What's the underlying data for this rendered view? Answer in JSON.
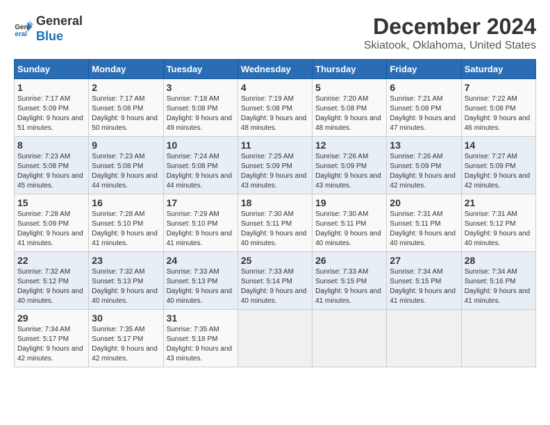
{
  "logo": {
    "text_general": "General",
    "text_blue": "Blue"
  },
  "title": "December 2024",
  "subtitle": "Skiatook, Oklahoma, United States",
  "calendar": {
    "headers": [
      "Sunday",
      "Monday",
      "Tuesday",
      "Wednesday",
      "Thursday",
      "Friday",
      "Saturday"
    ],
    "weeks": [
      [
        {
          "day": "1",
          "sunrise": "7:17 AM",
          "sunset": "5:09 PM",
          "daylight": "9 hours and 51 minutes."
        },
        {
          "day": "2",
          "sunrise": "7:17 AM",
          "sunset": "5:08 PM",
          "daylight": "9 hours and 50 minutes."
        },
        {
          "day": "3",
          "sunrise": "7:18 AM",
          "sunset": "5:08 PM",
          "daylight": "9 hours and 49 minutes."
        },
        {
          "day": "4",
          "sunrise": "7:19 AM",
          "sunset": "5:08 PM",
          "daylight": "9 hours and 48 minutes."
        },
        {
          "day": "5",
          "sunrise": "7:20 AM",
          "sunset": "5:08 PM",
          "daylight": "9 hours and 48 minutes."
        },
        {
          "day": "6",
          "sunrise": "7:21 AM",
          "sunset": "5:08 PM",
          "daylight": "9 hours and 47 minutes."
        },
        {
          "day": "7",
          "sunrise": "7:22 AM",
          "sunset": "5:08 PM",
          "daylight": "9 hours and 46 minutes."
        }
      ],
      [
        {
          "day": "8",
          "sunrise": "7:23 AM",
          "sunset": "5:08 PM",
          "daylight": "9 hours and 45 minutes."
        },
        {
          "day": "9",
          "sunrise": "7:23 AM",
          "sunset": "5:08 PM",
          "daylight": "9 hours and 44 minutes."
        },
        {
          "day": "10",
          "sunrise": "7:24 AM",
          "sunset": "5:08 PM",
          "daylight": "9 hours and 44 minutes."
        },
        {
          "day": "11",
          "sunrise": "7:25 AM",
          "sunset": "5:09 PM",
          "daylight": "9 hours and 43 minutes."
        },
        {
          "day": "12",
          "sunrise": "7:26 AM",
          "sunset": "5:09 PM",
          "daylight": "9 hours and 43 minutes."
        },
        {
          "day": "13",
          "sunrise": "7:26 AM",
          "sunset": "5:09 PM",
          "daylight": "9 hours and 42 minutes."
        },
        {
          "day": "14",
          "sunrise": "7:27 AM",
          "sunset": "5:09 PM",
          "daylight": "9 hours and 42 minutes."
        }
      ],
      [
        {
          "day": "15",
          "sunrise": "7:28 AM",
          "sunset": "5:09 PM",
          "daylight": "9 hours and 41 minutes."
        },
        {
          "day": "16",
          "sunrise": "7:28 AM",
          "sunset": "5:10 PM",
          "daylight": "9 hours and 41 minutes."
        },
        {
          "day": "17",
          "sunrise": "7:29 AM",
          "sunset": "5:10 PM",
          "daylight": "9 hours and 41 minutes."
        },
        {
          "day": "18",
          "sunrise": "7:30 AM",
          "sunset": "5:11 PM",
          "daylight": "9 hours and 40 minutes."
        },
        {
          "day": "19",
          "sunrise": "7:30 AM",
          "sunset": "5:11 PM",
          "daylight": "9 hours and 40 minutes."
        },
        {
          "day": "20",
          "sunrise": "7:31 AM",
          "sunset": "5:11 PM",
          "daylight": "9 hours and 40 minutes."
        },
        {
          "day": "21",
          "sunrise": "7:31 AM",
          "sunset": "5:12 PM",
          "daylight": "9 hours and 40 minutes."
        }
      ],
      [
        {
          "day": "22",
          "sunrise": "7:32 AM",
          "sunset": "5:12 PM",
          "daylight": "9 hours and 40 minutes."
        },
        {
          "day": "23",
          "sunrise": "7:32 AM",
          "sunset": "5:13 PM",
          "daylight": "9 hours and 40 minutes."
        },
        {
          "day": "24",
          "sunrise": "7:33 AM",
          "sunset": "5:13 PM",
          "daylight": "9 hours and 40 minutes."
        },
        {
          "day": "25",
          "sunrise": "7:33 AM",
          "sunset": "5:14 PM",
          "daylight": "9 hours and 40 minutes."
        },
        {
          "day": "26",
          "sunrise": "7:33 AM",
          "sunset": "5:15 PM",
          "daylight": "9 hours and 41 minutes."
        },
        {
          "day": "27",
          "sunrise": "7:34 AM",
          "sunset": "5:15 PM",
          "daylight": "9 hours and 41 minutes."
        },
        {
          "day": "28",
          "sunrise": "7:34 AM",
          "sunset": "5:16 PM",
          "daylight": "9 hours and 41 minutes."
        }
      ],
      [
        {
          "day": "29",
          "sunrise": "7:34 AM",
          "sunset": "5:17 PM",
          "daylight": "9 hours and 42 minutes."
        },
        {
          "day": "30",
          "sunrise": "7:35 AM",
          "sunset": "5:17 PM",
          "daylight": "9 hours and 42 minutes."
        },
        {
          "day": "31",
          "sunrise": "7:35 AM",
          "sunset": "5:18 PM",
          "daylight": "9 hours and 43 minutes."
        },
        null,
        null,
        null,
        null
      ]
    ]
  }
}
